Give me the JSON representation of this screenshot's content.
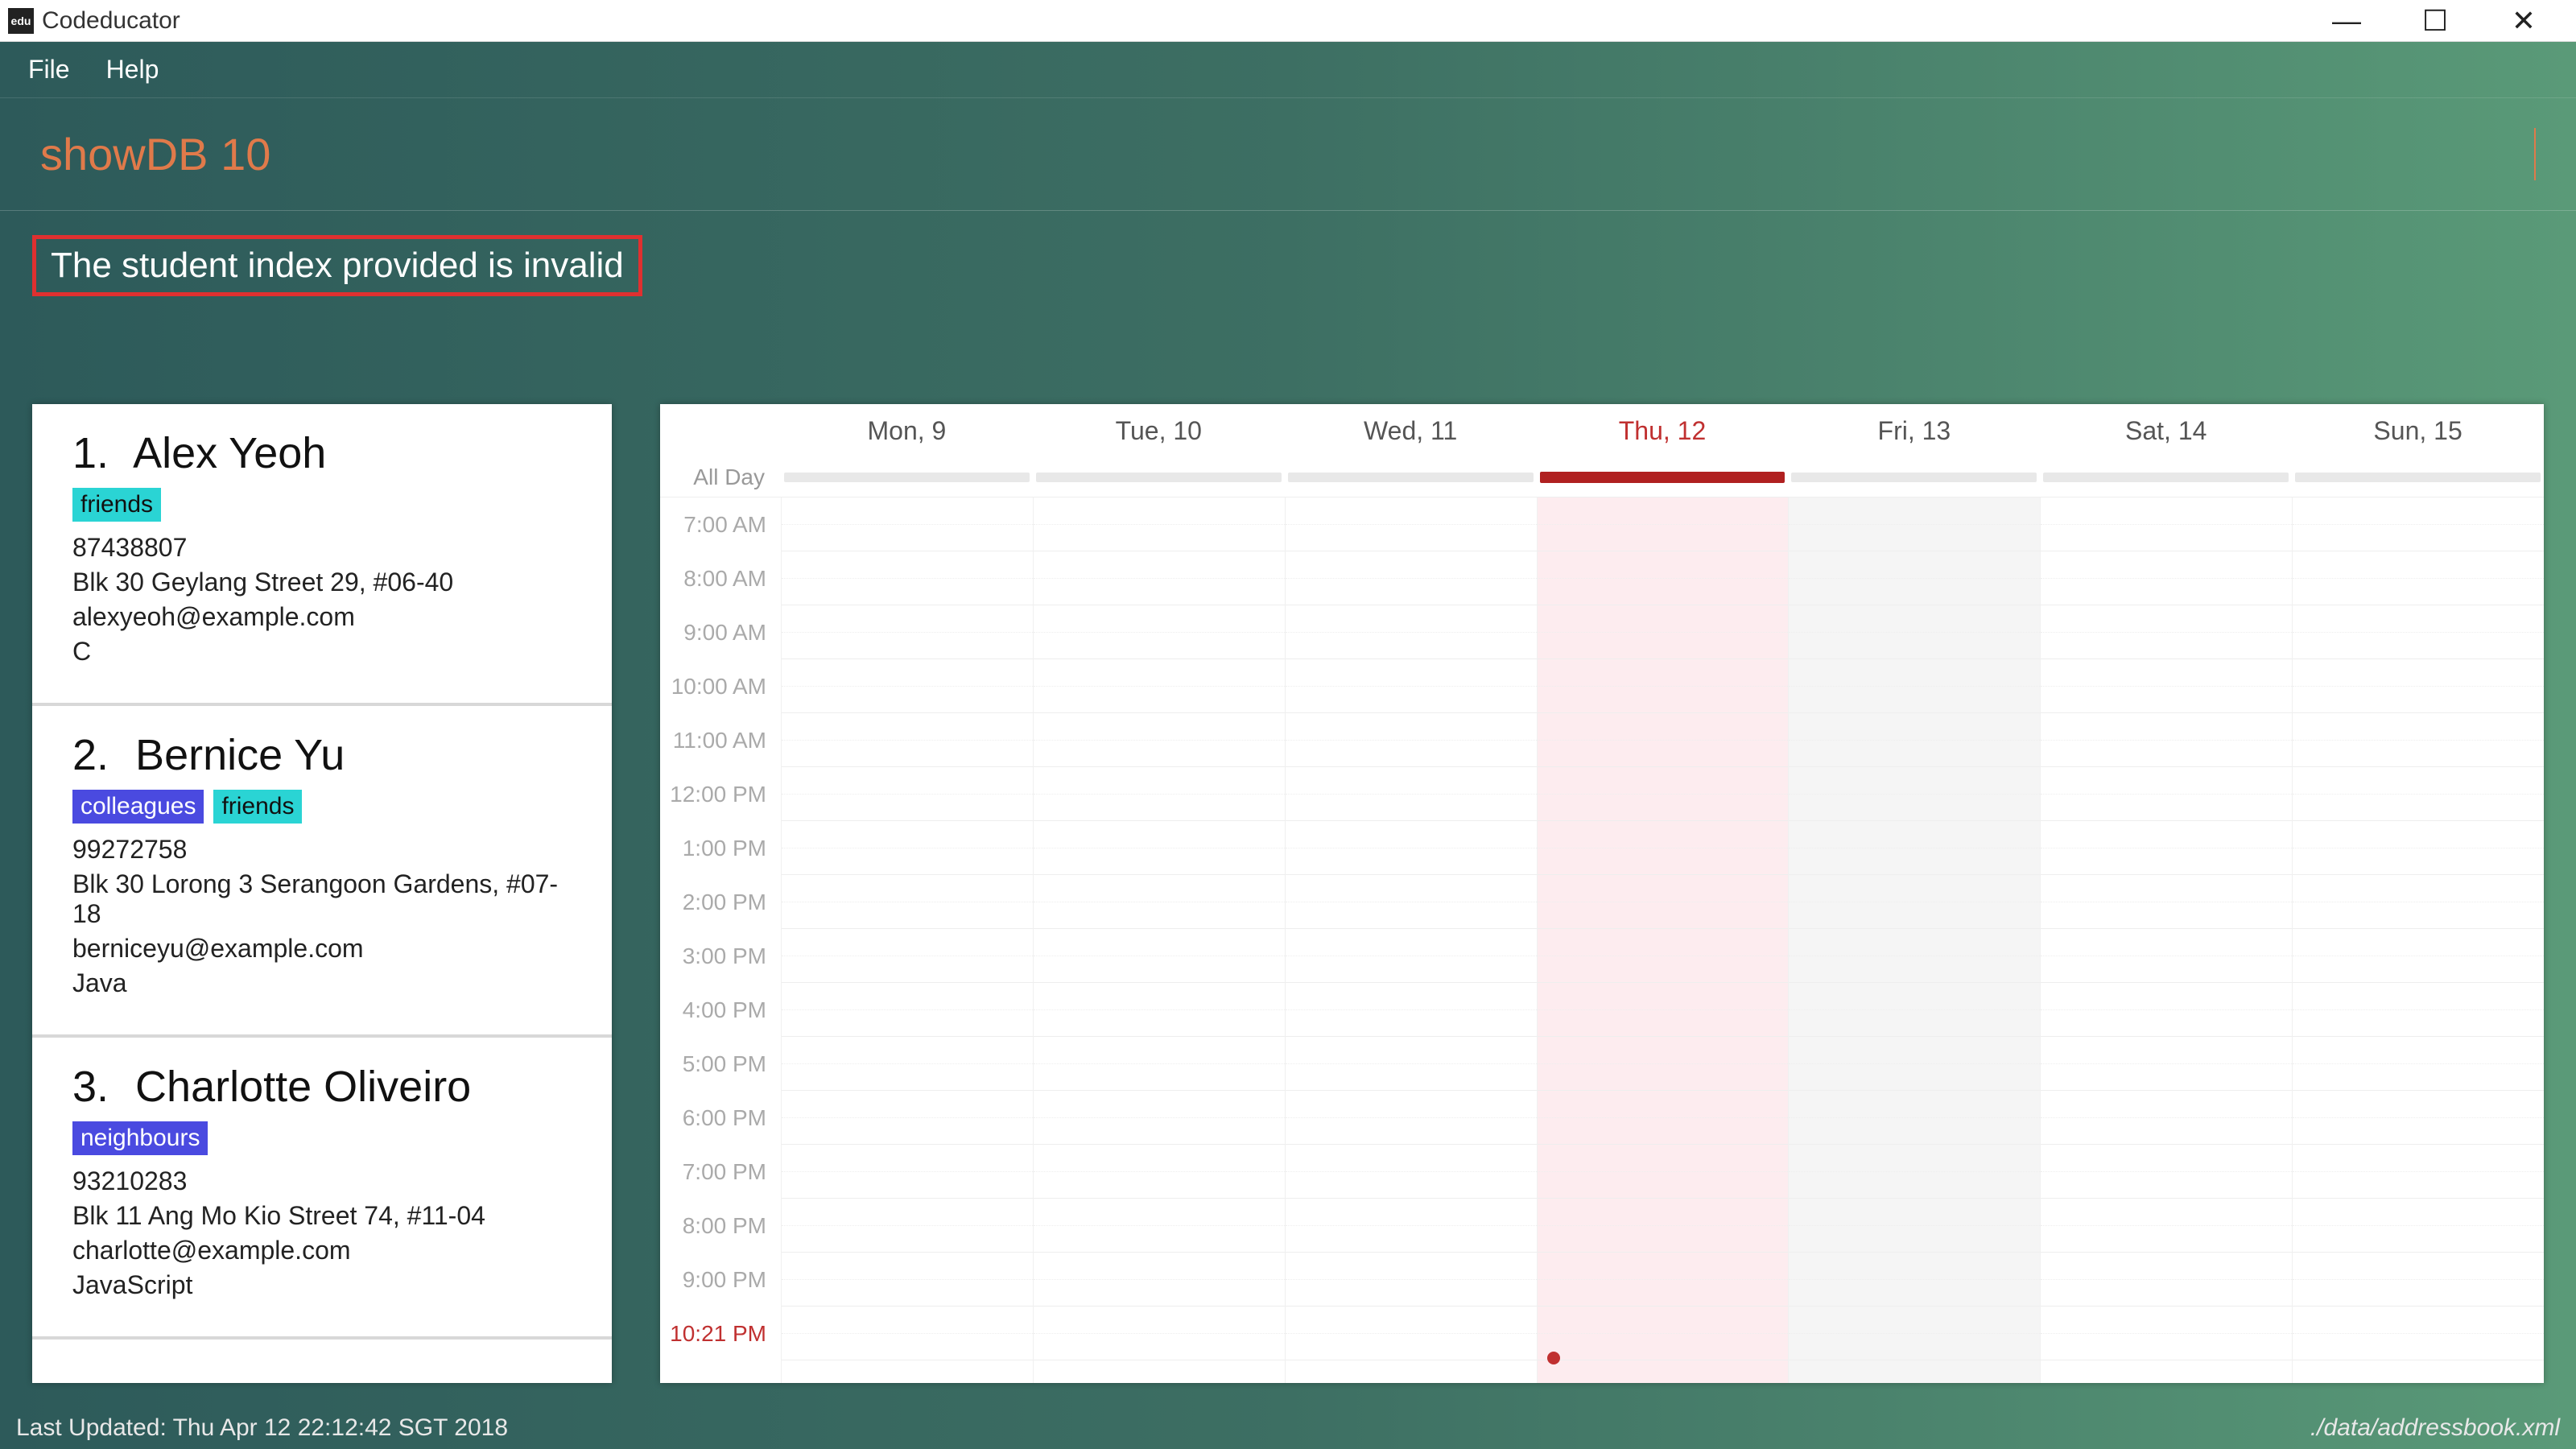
{
  "window": {
    "title": "Codeducator",
    "icon_text": "edu"
  },
  "menu": {
    "file": "File",
    "help": "Help"
  },
  "command_input": "showDB 10",
  "error_message": "The student index provided is invalid",
  "students": [
    {
      "index": "1.",
      "name": "Alex Yeoh",
      "tags": [
        {
          "label": "friends",
          "cls": "friends"
        }
      ],
      "phone": "87438807",
      "address": "Blk 30 Geylang Street 29, #06-40",
      "email": "alexyeoh@example.com",
      "lang": "C"
    },
    {
      "index": "2.",
      "name": "Bernice Yu",
      "tags": [
        {
          "label": "colleagues",
          "cls": "colleagues"
        },
        {
          "label": "friends",
          "cls": "friends"
        }
      ],
      "phone": "99272758",
      "address": "Blk 30 Lorong 3 Serangoon Gardens, #07-18",
      "email": "berniceyu@example.com",
      "lang": "Java"
    },
    {
      "index": "3.",
      "name": "Charlotte Oliveiro",
      "tags": [
        {
          "label": "neighbours",
          "cls": "neighbours"
        }
      ],
      "phone": "93210283",
      "address": "Blk 11 Ang Mo Kio Street 74, #11-04",
      "email": "charlotte@example.com",
      "lang": "JavaScript"
    }
  ],
  "calendar": {
    "allday_label": "All Day",
    "days": [
      {
        "label": "Mon, 9",
        "today": false
      },
      {
        "label": "Tue, 10",
        "today": false
      },
      {
        "label": "Wed, 11",
        "today": false
      },
      {
        "label": "Thu, 12",
        "today": true
      },
      {
        "label": "Fri, 13",
        "today": false,
        "shade": true
      },
      {
        "label": "Sat, 14",
        "today": false
      },
      {
        "label": "Sun, 15",
        "today": false
      }
    ],
    "time_labels": [
      "7:00 AM",
      "8:00 AM",
      "9:00 AM",
      "10:00 AM",
      "11:00 AM",
      "12:00 PM",
      "1:00 PM",
      "2:00 PM",
      "3:00 PM",
      "4:00 PM",
      "5:00 PM",
      "6:00 PM",
      "7:00 PM",
      "8:00 PM",
      "9:00 PM",
      "10:21 PM"
    ],
    "now_label": "10:21 PM"
  },
  "status": {
    "left": "Last Updated: Thu Apr 12 22:12:42 SGT 2018",
    "right": "./data/addressbook.xml"
  }
}
